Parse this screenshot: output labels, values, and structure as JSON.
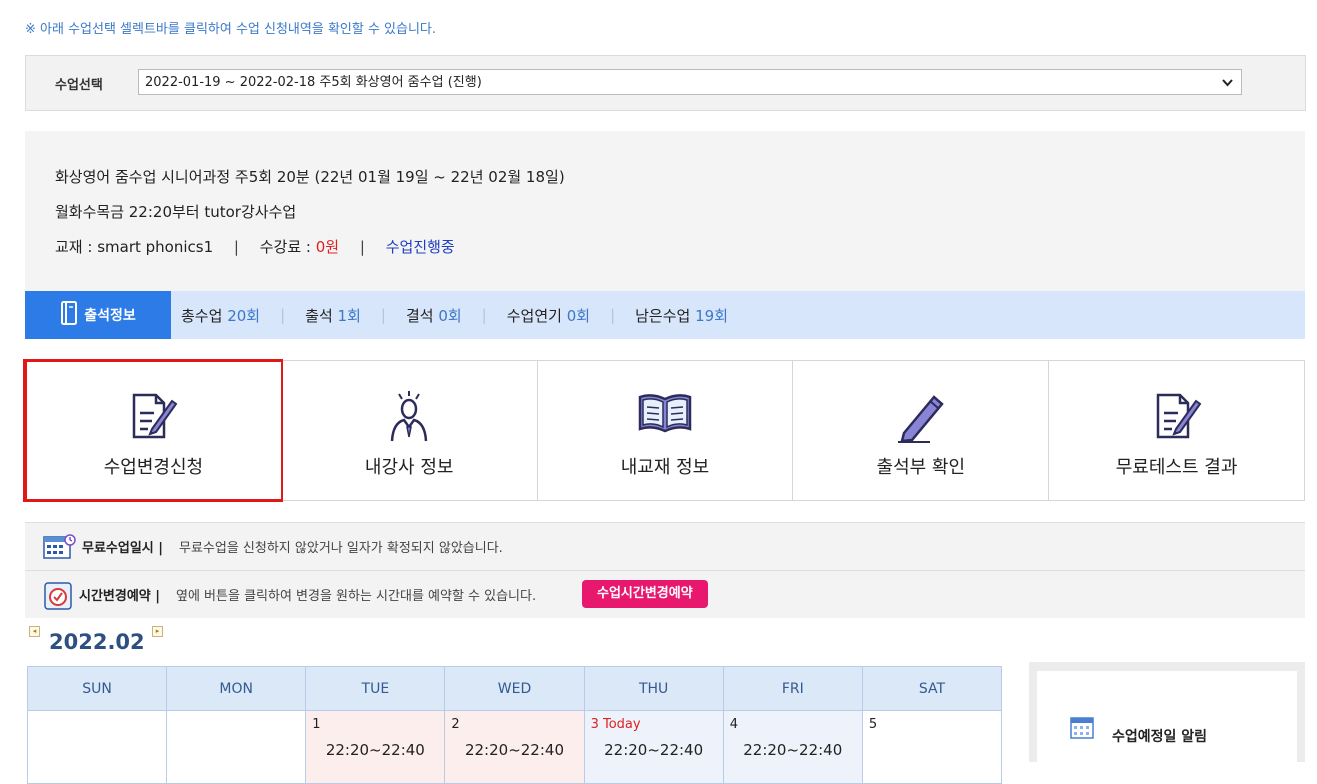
{
  "notice": "※ 아래 수업선택 셀렉트바를 클릭하여 수업 신청내역을 확인할 수 있습니다.",
  "course_select": {
    "label": "수업선택",
    "value": "2022-01-19 ~ 2022-02-18 주5회 화상영어 줌수업 (진행)"
  },
  "course_info": {
    "title": "화상영어 줌수업 시니어과정 주5회 20분 (22년 01월 19일 ~ 22년 02월 18일)",
    "schedule": "월화수목금 22:20부터 tutor강사수업",
    "textbook_label": "교재 : ",
    "textbook": "smart phonics1",
    "fee_label": "수강료 : ",
    "fee": "0원",
    "status": "수업진행중",
    "separator": "|"
  },
  "attendance": {
    "title": "출석정보",
    "items": [
      {
        "label": "총수업",
        "value": "20회"
      },
      {
        "label": "출석",
        "value": "1회"
      },
      {
        "label": "결석",
        "value": "0회"
      },
      {
        "label": "수업연기",
        "value": "0회"
      },
      {
        "label": "남은수업",
        "value": "19회"
      }
    ],
    "separator": "|"
  },
  "menu": [
    {
      "label": "수업변경신청",
      "icon": "edit-document-icon",
      "selected": true
    },
    {
      "label": "내강사 정보",
      "icon": "teacher-icon",
      "selected": false
    },
    {
      "label": "내교재 정보",
      "icon": "open-book-icon",
      "selected": false
    },
    {
      "label": "출석부 확인",
      "icon": "pencil-icon",
      "selected": false
    },
    {
      "label": "무료테스트 결과",
      "icon": "edit-document-icon",
      "selected": false
    }
  ],
  "free_class": {
    "title": "무료수업일시 |",
    "text": "무료수업을 신청하지 않았거나 일자가 확정되지 않았습니다."
  },
  "time_change": {
    "title": "시간변경예약 |",
    "text": "옆에 버튼을 클릭하여 변경을 원하는 시간대를 예약할 수 있습니다.",
    "button": "수업시간변경예약"
  },
  "calendar": {
    "month": "2022.02",
    "prev": "◂",
    "next": "▸",
    "days": [
      "SUN",
      "MON",
      "TUE",
      "WED",
      "THU",
      "FRI",
      "SAT"
    ],
    "first_week": [
      {
        "day": "",
        "slot": ""
      },
      {
        "day": "",
        "slot": ""
      },
      {
        "day": "1",
        "slot": "22:20~22:40"
      },
      {
        "day": "2",
        "slot": "22:20~22:40"
      },
      {
        "day": "3 Today",
        "slot": "22:20~22:40"
      },
      {
        "day": "4",
        "slot": "22:20~22:40"
      },
      {
        "day": "5",
        "slot": ""
      }
    ]
  },
  "side": {
    "title": "수업예정일 알림",
    "icon": "calendar-icon"
  },
  "colors": {
    "accent_blue": "#2d7be6",
    "selected_border": "#e01818",
    "button_pink": "#e8186e",
    "fee_red": "#e02020"
  }
}
